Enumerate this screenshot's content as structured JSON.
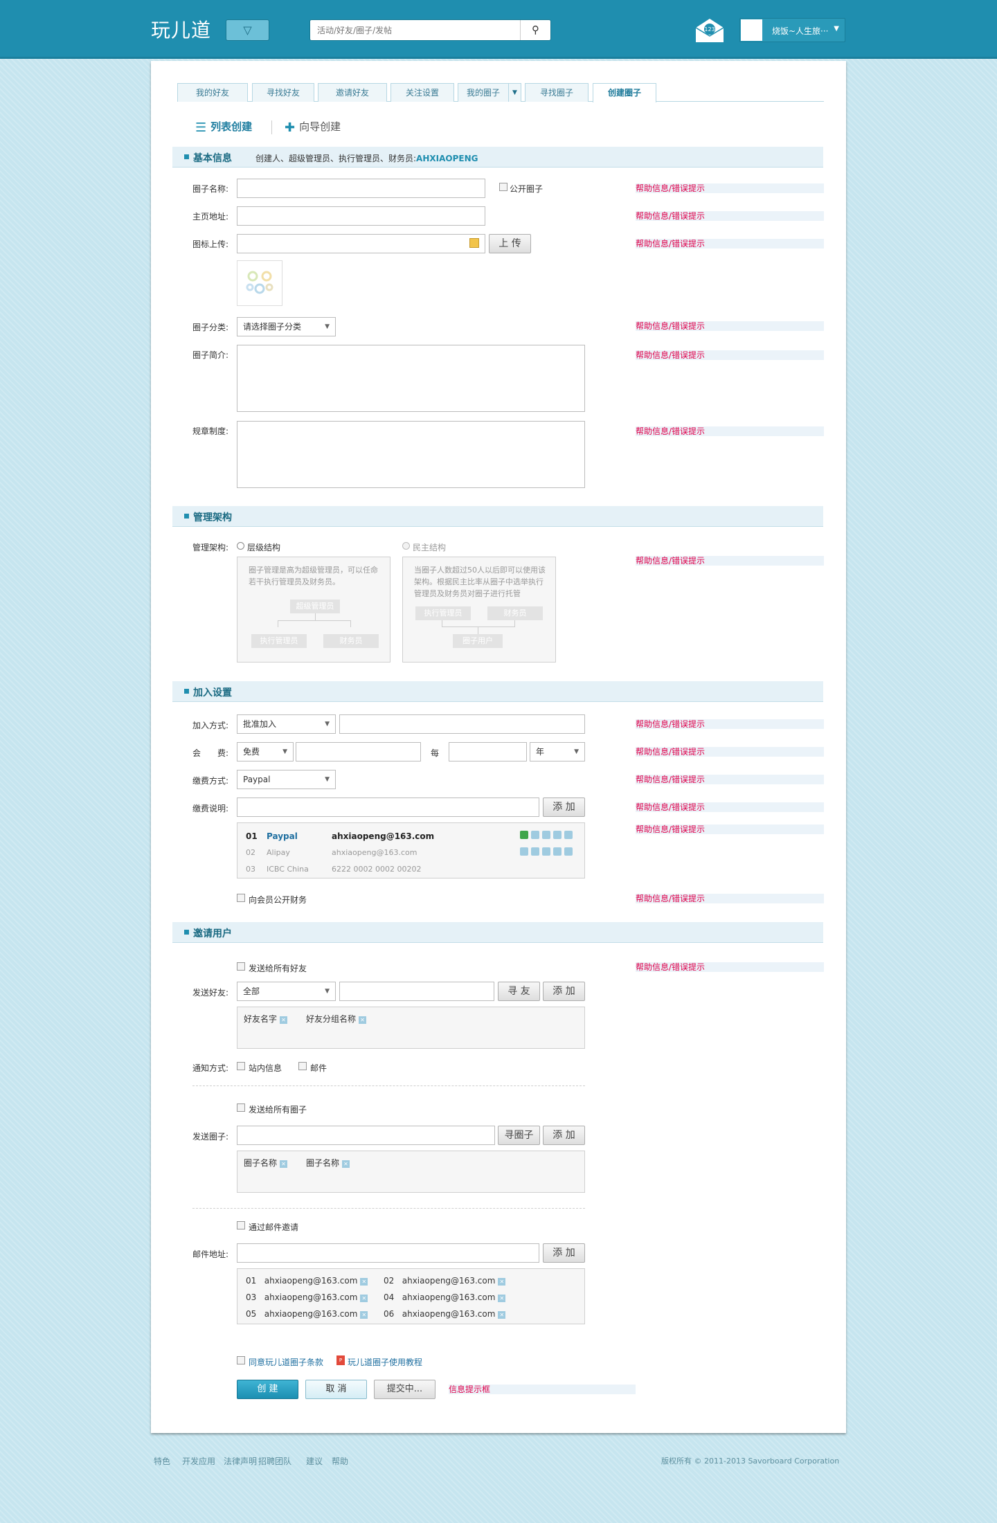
{
  "header": {
    "logo": "玩儿道",
    "search_placeholder": "活动/好友/圈子/发帖",
    "mail_count": "123",
    "user_name": "烧饭~人生旅···"
  },
  "tabs": [
    "我的好友",
    "寻找好友",
    "邀请好友",
    "关注设置",
    "我的圈子",
    "寻找圈子",
    "创建圈子"
  ],
  "modes": {
    "list": "列表创建",
    "wizard": "向导创建"
  },
  "help_text": "帮助信息/错误提示",
  "basic": {
    "title": "基本信息",
    "subtitle": "创建人、超级管理员、执行管理员、财务员:",
    "owner": "AHXIAOPENG",
    "name_label": "圈子名称:",
    "public_label": "公开圈子",
    "home_label": "主页地址:",
    "icon_label": "图标上传:",
    "upload_btn": "上 传",
    "cat_label": "圈子分类:",
    "cat_value": "请选择圈子分类",
    "intro_label": "圈子简介:",
    "rules_label": "规章制度:"
  },
  "mgmt": {
    "title": "管理架构",
    "label": "管理架构:",
    "opt1": "层级结构",
    "opt1_desc": "圈子管理是高为超级管理员，可以任命若干执行管理员及财务员。",
    "opt1_nodes": [
      "超级管理员",
      "执行管理员",
      "财务员"
    ],
    "opt2": "民主结构",
    "opt2_desc": "当圈子人数超过50人以后即可以使用该架构。根据民主比率从圈子中选举执行管理员及财务员对圈子进行托管",
    "opt2_nodes": [
      "执行管理员",
      "财务员",
      "圈子用户"
    ]
  },
  "join": {
    "title": "加入设置",
    "way_label": "加入方式:",
    "way_value": "批准加入",
    "fee_label": "会　　费:",
    "fee_value": "免费",
    "per": "每",
    "period": "年",
    "pay_label": "缴费方式:",
    "pay_value": "Paypal",
    "desc_label": "缴费说明:",
    "add_btn": "添 加",
    "accounts": [
      {
        "no": "01",
        "name": "Paypal",
        "acct": "ahxiaopeng@163.com"
      },
      {
        "no": "02",
        "name": "Alipay",
        "acct": "ahxiaopeng@163.com"
      },
      {
        "no": "03",
        "name": "ICBC China",
        "acct": "6222 0002 0002 00202"
      }
    ],
    "public_finance": "向会员公开财务"
  },
  "invite": {
    "title": "邀请用户",
    "all_friends": "发送给所有好友",
    "friend_label": "发送好友:",
    "friend_sel": "全部",
    "find_btn": "寻 友",
    "add_btn": "添 加",
    "friend_tags": [
      "好友名字",
      "好友分组名称"
    ],
    "notify_label": "通知方式:",
    "notify_opts": [
      "站内信息",
      "邮件"
    ],
    "all_circles": "发送给所有圈子",
    "circle_label": "发送圈子:",
    "find_circle_btn": "寻圈子",
    "circle_tags": [
      "圈子名称",
      "圈子名称"
    ],
    "by_email": "通过邮件邀请",
    "email_label": "邮件地址:",
    "emails": [
      [
        "01",
        "ahxiaopeng@163.com"
      ],
      [
        "02",
        "ahxiaopeng@163.com"
      ],
      [
        "03",
        "ahxiaopeng@163.com"
      ],
      [
        "04",
        "ahxiaopeng@163.com"
      ],
      [
        "05",
        "ahxiaopeng@163.com"
      ],
      [
        "06",
        "ahxiaopeng@163.com"
      ]
    ]
  },
  "bottom": {
    "agree": "同意玩儿道圈子条款",
    "tutorial": "玩儿道圈子使用教程",
    "create": "创 建",
    "cancel": "取 消",
    "submitting": "提交中...",
    "info": "信息提示框"
  },
  "footer": {
    "links": [
      "特色",
      "开发应用",
      "法律声明",
      "招聘团队",
      "建议",
      "帮助"
    ],
    "copyright": "版权所有 © 2011-2013 Savorboard Corporation"
  }
}
